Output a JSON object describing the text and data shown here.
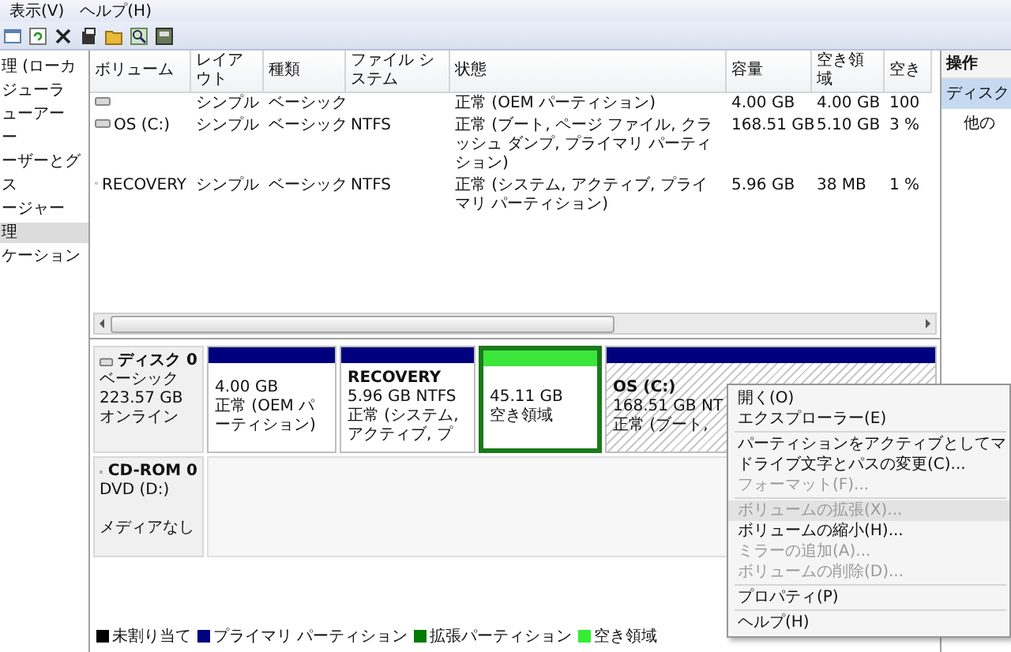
{
  "menu_bar": [
    "表示(V)",
    "ヘルプ(H)"
  ],
  "tree": [
    {
      "label": "理 (ローカ",
      "selected": false
    },
    {
      "label": "ジューラ",
      "selected": false
    },
    {
      "label": "ューアー",
      "selected": false
    },
    {
      "label": "ー",
      "selected": false
    },
    {
      "label": "ーザーとグ",
      "selected": false
    },
    {
      "label": "ス",
      "selected": false
    },
    {
      "label": "ージャー",
      "selected": false
    },
    {
      "label": "理",
      "selected": true
    },
    {
      "label": "ケーション",
      "selected": false
    }
  ],
  "table": {
    "columns": [
      "ボリューム",
      "レイアウト",
      "種類",
      "ファイル システム",
      "状態",
      "容量",
      "空き領域",
      "空き"
    ],
    "rows": [
      {
        "cells": [
          "",
          "シンプル",
          "ベーシック",
          "",
          "正常 (OEM パーティション)",
          "4.00 GB",
          "4.00 GB",
          "100"
        ]
      },
      {
        "cells": [
          "OS (C:)",
          "シンプル",
          "ベーシック",
          "NTFS",
          "正常 (ブート, ページ ファイル, クラッシュ ダンプ, プライマリ パーティション)",
          "168.51 GB",
          "5.10 GB",
          "3 %"
        ]
      },
      {
        "cells": [
          "RECOVERY",
          "シンプル",
          "ベーシック",
          "NTFS",
          "正常 (システム, アクティブ, プライマリ パーティション)",
          "5.96 GB",
          "38 MB",
          "1 %"
        ]
      }
    ]
  },
  "disks": [
    {
      "kind": "disk",
      "name": "ディスク 0",
      "type": "ベーシック",
      "size": "223.57 GB",
      "status": "オンライン",
      "partitions": [
        {
          "kind": "primary",
          "size": "4.00 GB",
          "status": "正常 (OEM パーティション)",
          "selected": false,
          "focused": false
        },
        {
          "kind": "primary",
          "name": "RECOVERY",
          "size": "5.96 GB NTFS",
          "status": "正常 (システム, アクティブ, プ",
          "selected": false,
          "focused": false
        },
        {
          "kind": "free",
          "size": "45.11 GB",
          "status": "空き領域",
          "selected": false,
          "focused": true
        },
        {
          "kind": "primary",
          "name": "OS (C:)",
          "size": "168.51 GB NT",
          "status": "正常 (ブート,",
          "selected": true,
          "focused": false
        }
      ]
    },
    {
      "kind": "cdrom",
      "name": "CD-ROM 0",
      "type": "DVD (D:)",
      "status": "メディアなし"
    }
  ],
  "legend": [
    {
      "label": "未割り当て",
      "color": "#000000"
    },
    {
      "label": "プライマリ パーティション",
      "color": "#000080"
    },
    {
      "label": "拡張パーティション",
      "color": "#007a00"
    },
    {
      "label": "空き領域",
      "color": "#33ee33"
    }
  ],
  "actions": {
    "title": "操作",
    "items": [
      {
        "label": "ディスク",
        "selected": true
      },
      {
        "label": "他の",
        "selected": false
      }
    ]
  },
  "context_menu": [
    {
      "kind": "item",
      "label": "開く(O)",
      "disabled": false,
      "selected": false
    },
    {
      "kind": "item",
      "label": "エクスプローラー(E)",
      "disabled": false,
      "selected": false
    },
    {
      "kind": "separator"
    },
    {
      "kind": "item",
      "label": "パーティションをアクティブとしてマ",
      "disabled": false,
      "selected": false
    },
    {
      "kind": "item",
      "label": "ドライブ文字とパスの変更(C)...",
      "disabled": false,
      "selected": false
    },
    {
      "kind": "item",
      "label": "フォーマット(F)...",
      "disabled": true,
      "selected": false
    },
    {
      "kind": "separator"
    },
    {
      "kind": "item",
      "label": "ボリュームの拡張(X)...",
      "disabled": true,
      "selected": true
    },
    {
      "kind": "item",
      "label": "ボリュームの縮小(H)...",
      "disabled": false,
      "selected": false
    },
    {
      "kind": "item",
      "label": "ミラーの追加(A)...",
      "disabled": true,
      "selected": false
    },
    {
      "kind": "item",
      "label": "ボリュームの削除(D)...",
      "disabled": true,
      "selected": false
    },
    {
      "kind": "separator"
    },
    {
      "kind": "item",
      "label": "プロパティ(P)",
      "disabled": false,
      "selected": false
    },
    {
      "kind": "separator"
    },
    {
      "kind": "item",
      "label": "ヘルプ(H)",
      "disabled": false,
      "selected": false
    }
  ]
}
